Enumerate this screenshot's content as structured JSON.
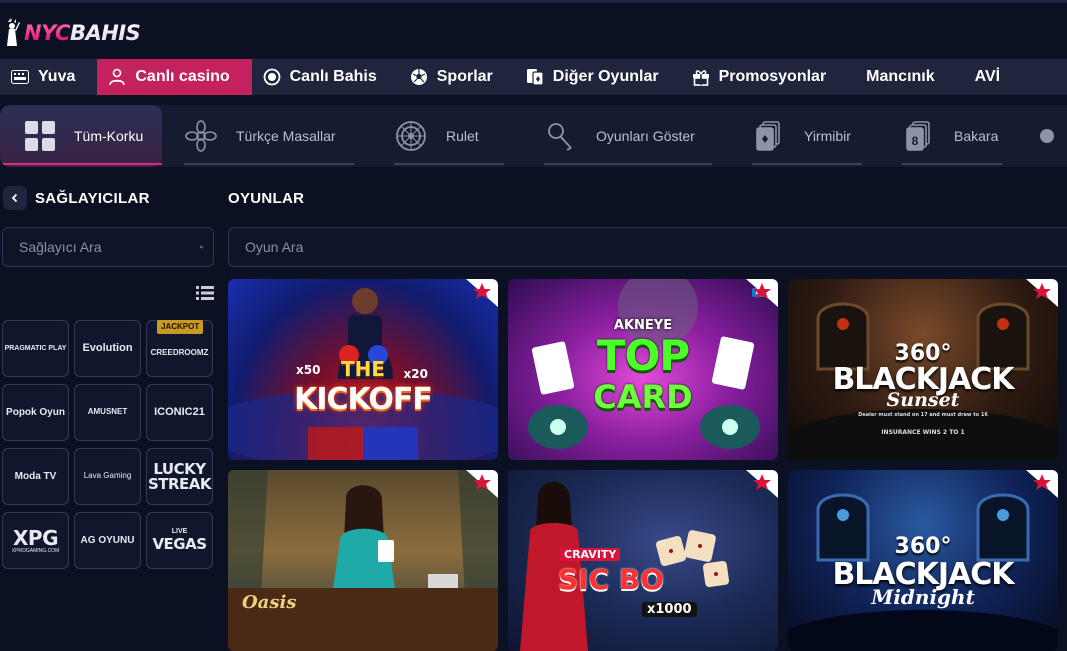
{
  "brand": {
    "logo_part1": "NYC",
    "logo_part2": "BAHIS"
  },
  "main_nav": [
    {
      "label": "Yuva",
      "icon": "keyboard-icon"
    },
    {
      "label": "Canlı casino",
      "icon": "dealer-icon",
      "active": true
    },
    {
      "label": "Canlı Bahis",
      "icon": "live-dot-icon"
    },
    {
      "label": "Sporlar",
      "icon": "soccer-ball-icon"
    },
    {
      "label": "Diğer Oyunlar",
      "icon": "cards-icon"
    },
    {
      "label": "Promosyonlar",
      "icon": "gift-icon"
    },
    {
      "label": "Mancınık",
      "icon": ""
    },
    {
      "label": "AVİ",
      "icon": ""
    }
  ],
  "categories": [
    {
      "label": "Tüm-Korku",
      "icon": "grid-icon",
      "active": true
    },
    {
      "label": "Türkçe Masallar",
      "icon": "flower-icon"
    },
    {
      "label": "Rulet",
      "icon": "roulette-icon"
    },
    {
      "label": "Oyunları Göster",
      "icon": "microphone-icon"
    },
    {
      "label": "Yirmibir",
      "icon": "blackjack-cards-icon"
    },
    {
      "label": "Bakara",
      "icon": "baccarat-cards-icon"
    }
  ],
  "sidebar": {
    "title": "SAĞLAYICILAR",
    "search_placeholder": "Sağlayıcı Ara",
    "providers": [
      {
        "label": "PRAGMATIC PLAY"
      },
      {
        "label": "Evolution"
      },
      {
        "label": "CREEDROOMZ",
        "badge": "JACKPOT"
      },
      {
        "label": "Popok Oyun"
      },
      {
        "label": "AMUSNET"
      },
      {
        "label": "ICONIC21"
      },
      {
        "label": "Moda TV"
      },
      {
        "label": "Lava Gaming"
      },
      {
        "label": "LUCKY STREAK"
      },
      {
        "label": "XPG",
        "sub": "XPROGAMING.COM"
      },
      {
        "label": "AG OYUNU"
      },
      {
        "label": "VEGAS",
        "sub": "LIVE"
      }
    ]
  },
  "games_section": {
    "title": "OYUNLAR",
    "search_placeholder": "Oyun Ara",
    "games": [
      {
        "title_top": "THE",
        "title_main": "KICKOFF",
        "mult_left": "x50",
        "mult_right": "x20"
      },
      {
        "title_top": "AKNEYE",
        "title_main": "TOP",
        "title_sub": "CARD",
        "badge": "LIVE"
      },
      {
        "title_top": "360°",
        "title_main": "BLACKJACK",
        "title_sub": "Sunset",
        "fine_print": "Dealer must stand on 17 and must draw to 16",
        "insurance": "INSURANCE WINS 2 TO 1"
      },
      {
        "title_main": "Oasis"
      },
      {
        "title_top": "CRAVITY",
        "title_main": "SIC BO",
        "mult": "x1000"
      },
      {
        "title_top": "360°",
        "title_main": "BLACKJACK",
        "title_sub": "Midnight"
      }
    ]
  }
}
